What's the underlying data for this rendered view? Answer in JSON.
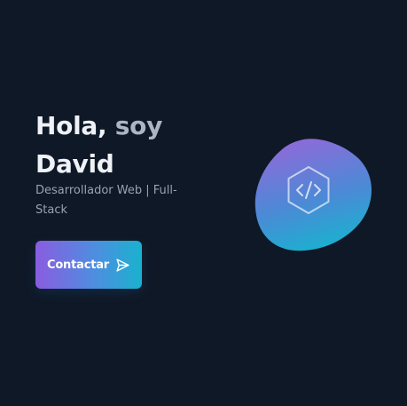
{
  "hero": {
    "greeting": "Hola,",
    "greeting_tail": "soy",
    "name": "David",
    "role": "Desarrollador Web | Full-Stack",
    "cta_label": "Contactar",
    "cta_icon": "send-icon",
    "emblem_icon": "code-hexagon-icon"
  },
  "colors": {
    "background": "#0f1826",
    "gradient_start": "#8a5ce0",
    "gradient_end": "#19b2cf",
    "heading": "#eef1f6",
    "muted": "#97a3b2"
  }
}
